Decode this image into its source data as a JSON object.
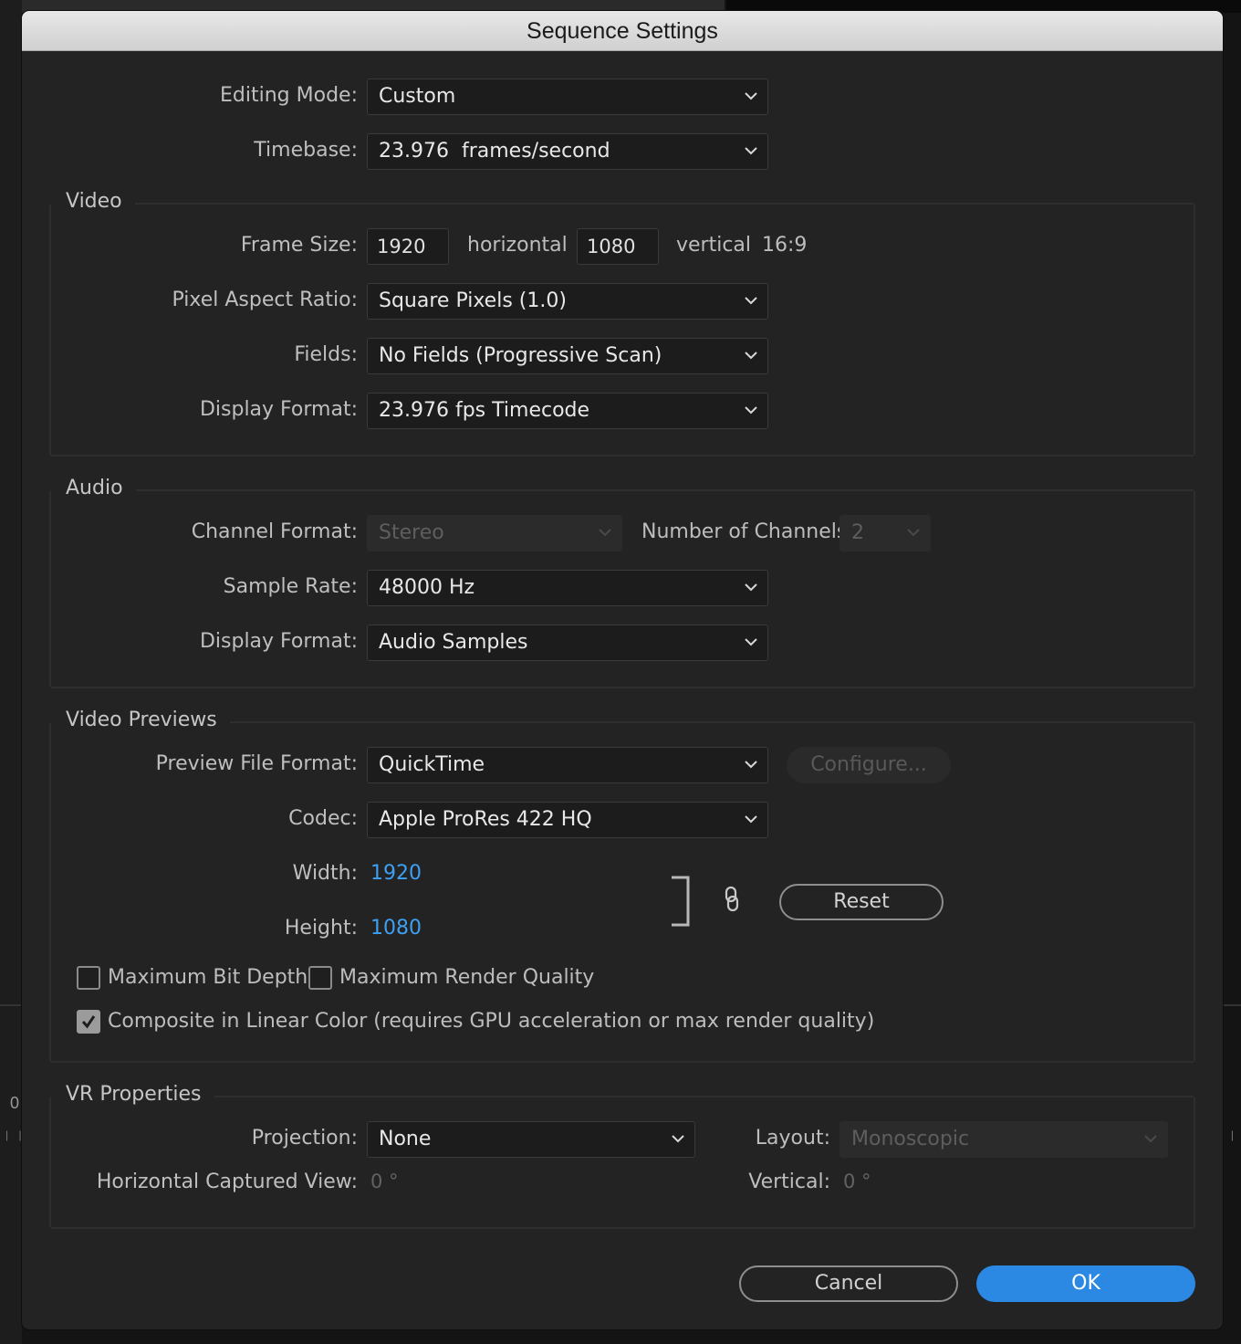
{
  "dialog": {
    "title": "Sequence Settings"
  },
  "general": {
    "editing_mode_label": "Editing Mode:",
    "editing_mode_value": "Custom",
    "timebase_label": "Timebase:",
    "timebase_value": "23.976  frames/second"
  },
  "video": {
    "title": "Video",
    "frame_size_label": "Frame Size:",
    "frame_width": "1920",
    "horizontal_label": "horizontal",
    "frame_height": "1080",
    "vertical_label": "vertical",
    "aspect": "16:9",
    "par_label": "Pixel Aspect Ratio:",
    "par_value": "Square Pixels (1.0)",
    "fields_label": "Fields:",
    "fields_value": "No Fields (Progressive Scan)",
    "display_format_label": "Display Format:",
    "display_format_value": "23.976 fps Timecode"
  },
  "audio": {
    "title": "Audio",
    "channel_format_label": "Channel Format:",
    "channel_format_value": "Stereo",
    "num_channels_label": "Number of Channels:",
    "num_channels_value": "2",
    "sample_rate_label": "Sample Rate:",
    "sample_rate_value": "48000 Hz",
    "display_format_label": "Display Format:",
    "display_format_value": "Audio Samples"
  },
  "previews": {
    "title": "Video Previews",
    "file_format_label": "Preview File Format:",
    "file_format_value": "QuickTime",
    "configure_label": "Configure...",
    "codec_label": "Codec:",
    "codec_value": "Apple ProRes 422 HQ",
    "width_label": "Width:",
    "width_value": "1920",
    "height_label": "Height:",
    "height_value": "1080",
    "reset_label": "Reset",
    "max_bit_depth_label": "Maximum Bit Depth",
    "max_bit_depth_checked": false,
    "max_render_quality_label": "Maximum Render Quality",
    "max_render_quality_checked": false,
    "linear_color_label": "Composite in Linear Color (requires GPU acceleration or max render quality)",
    "linear_color_checked": true
  },
  "vr": {
    "title": "VR Properties",
    "projection_label": "Projection:",
    "projection_value": "None",
    "layout_label": "Layout:",
    "layout_value": "Monoscopic",
    "h_captured_label": "Horizontal Captured View:",
    "h_captured_value": "0 °",
    "vertical_label": "Vertical:",
    "vertical_value": "0 °"
  },
  "footer": {
    "cancel_label": "Cancel",
    "ok_label": "OK"
  },
  "background": {
    "zero": "0",
    "ticks": "| |"
  },
  "colors": {
    "accent": "#2b88e3",
    "link_value": "#3f9ff1",
    "dialog_bg": "#232323",
    "titlebar": "#dcdcdc"
  }
}
